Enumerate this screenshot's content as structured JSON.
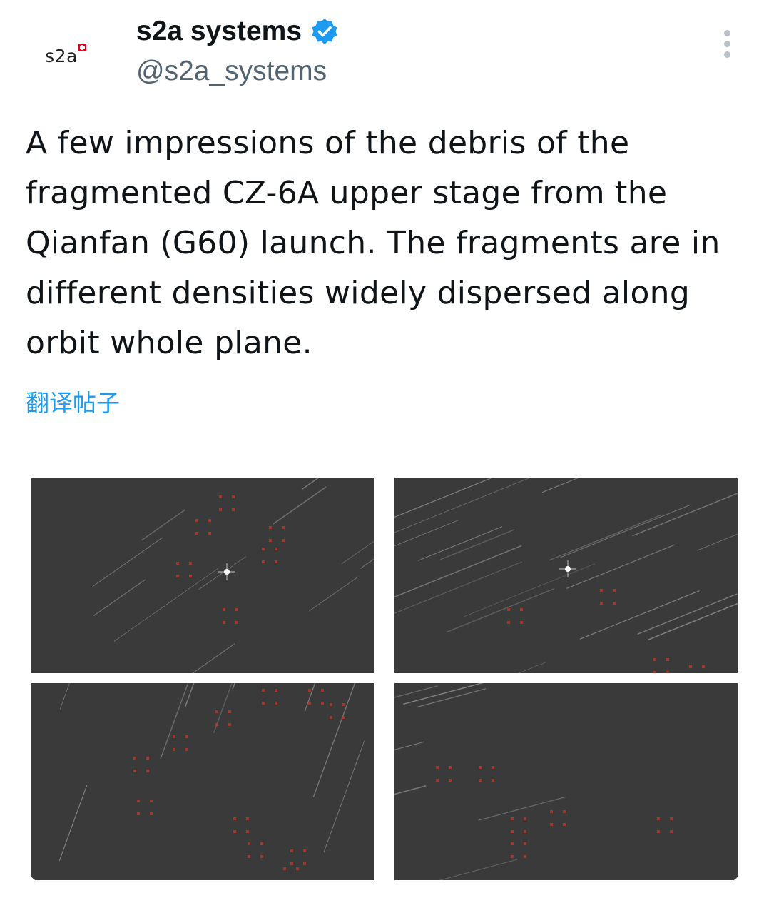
{
  "author": {
    "display_name": "s2a systems",
    "handle": "@s2a_systems",
    "avatar_text": "s2a",
    "verified": true,
    "verified_color": "#1d9bf0"
  },
  "tweet": {
    "text": "A few impressions of the debris of the fragmented CZ-6A upper stage from the Qianfan (G60) launch. The fragments are in different densities widely dispersed along orbit whole plane.",
    "translate_label": "翻译帖子"
  },
  "media": {
    "count": 4,
    "items": [
      {
        "icon": "night-sky-image",
        "content": "star-streaks-with-marked-debris"
      },
      {
        "icon": "night-sky-image",
        "content": "star-streaks-with-marked-debris"
      },
      {
        "icon": "night-sky-image",
        "content": "star-streaks-with-marked-debris"
      },
      {
        "icon": "night-sky-image",
        "content": "star-streaks-with-marked-debris"
      }
    ]
  },
  "colors": {
    "text_primary": "#0f1419",
    "text_secondary": "#536471",
    "link": "#1d9bf0",
    "image_background": "#3a3a3a",
    "debris_marker": "#c0392b"
  }
}
